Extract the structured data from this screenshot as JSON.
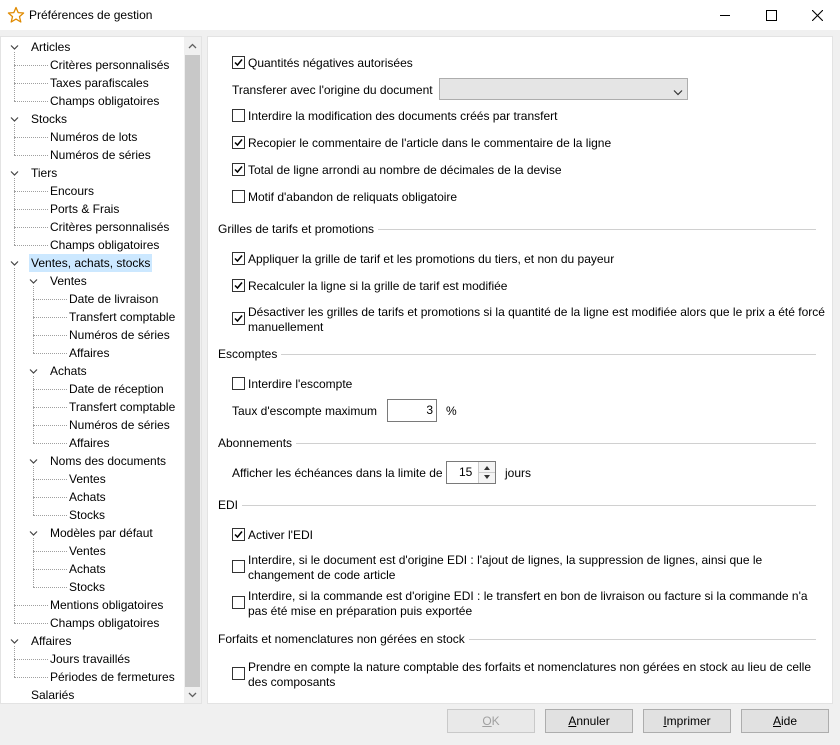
{
  "window": {
    "title": "Préférences de gestion"
  },
  "tree": [
    {
      "label": "Articles",
      "level": 0,
      "expanded": true
    },
    {
      "label": "Critères personnalisés",
      "level": 1
    },
    {
      "label": "Taxes parafiscales",
      "level": 1
    },
    {
      "label": "Champs obligatoires",
      "level": 1
    },
    {
      "label": "Stocks",
      "level": 0,
      "expanded": true
    },
    {
      "label": "Numéros de lots",
      "level": 1
    },
    {
      "label": "Numéros de séries",
      "level": 1
    },
    {
      "label": "Tiers",
      "level": 0,
      "expanded": true
    },
    {
      "label": "Encours",
      "level": 1
    },
    {
      "label": "Ports & Frais",
      "level": 1
    },
    {
      "label": "Critères personnalisés",
      "level": 1
    },
    {
      "label": "Champs obligatoires",
      "level": 1
    },
    {
      "label": "Ventes, achats, stocks",
      "level": 0,
      "expanded": true,
      "selected": true
    },
    {
      "label": "Ventes",
      "level": 1,
      "expanded": true
    },
    {
      "label": "Date de livraison",
      "level": 2
    },
    {
      "label": "Transfert comptable",
      "level": 2
    },
    {
      "label": "Numéros de séries",
      "level": 2
    },
    {
      "label": "Affaires",
      "level": 2
    },
    {
      "label": "Achats",
      "level": 1,
      "expanded": true
    },
    {
      "label": "Date de réception",
      "level": 2
    },
    {
      "label": "Transfert comptable",
      "level": 2
    },
    {
      "label": "Numéros de séries",
      "level": 2
    },
    {
      "label": "Affaires",
      "level": 2
    },
    {
      "label": "Noms des documents",
      "level": 1,
      "expanded": true
    },
    {
      "label": "Ventes",
      "level": 2
    },
    {
      "label": "Achats",
      "level": 2
    },
    {
      "label": "Stocks",
      "level": 2
    },
    {
      "label": "Modèles par défaut",
      "level": 1,
      "expanded": true
    },
    {
      "label": "Ventes",
      "level": 2
    },
    {
      "label": "Achats",
      "level": 2
    },
    {
      "label": "Stocks",
      "level": 2
    },
    {
      "label": "Mentions obligatoires",
      "level": 1
    },
    {
      "label": "Champs obligatoires",
      "level": 1
    },
    {
      "label": "Affaires",
      "level": 0,
      "expanded": true
    },
    {
      "label": "Jours travaillés",
      "level": 1
    },
    {
      "label": "Périodes de fermetures",
      "level": 1
    },
    {
      "label": "Salariés",
      "level": 0,
      "expanded": true
    }
  ],
  "panel": {
    "items": [
      {
        "type": "checkbox",
        "label": "Quantités négatives autorisées",
        "checked": true
      },
      {
        "type": "combo",
        "label": "Transferer avec l'origine du document",
        "value": ""
      },
      {
        "type": "checkbox",
        "label": "Interdire la modification des documents créés par transfert",
        "checked": false
      },
      {
        "type": "checkbox",
        "label": "Recopier le commentaire de l'article dans le commentaire de la ligne",
        "checked": true
      },
      {
        "type": "checkbox",
        "label": "Total de ligne arrondi au nombre de décimales de la devise",
        "checked": true
      },
      {
        "type": "checkbox",
        "label": "Motif d'abandon de reliquats obligatoire",
        "checked": false
      },
      {
        "type": "section",
        "label": "Grilles de tarifs et promotions"
      },
      {
        "type": "checkbox",
        "label": "Appliquer la grille de tarif et les promotions du tiers, et non du payeur",
        "checked": true
      },
      {
        "type": "checkbox",
        "label": "Recalculer la ligne si la grille de tarif est modifiée",
        "checked": true
      },
      {
        "type": "checkbox",
        "label": "Désactiver les grilles de tarifs et promotions si la quantité de la ligne est modifiée alors que le prix a été forcé",
        "label2": "manuellement",
        "checked": true
      },
      {
        "type": "section",
        "label": "Escomptes"
      },
      {
        "type": "checkbox",
        "label": "Interdire l'escompte",
        "checked": false
      },
      {
        "type": "number",
        "label": "Taux d'escompte maximum",
        "value": "3",
        "unit": "%"
      },
      {
        "type": "section",
        "label": "Abonnements"
      },
      {
        "type": "spinner",
        "label": "Afficher les échéances dans la limite de",
        "value": "15",
        "unit": "jours"
      },
      {
        "type": "section",
        "label": "EDI"
      },
      {
        "type": "checkbox",
        "label": "Activer l'EDI",
        "checked": true
      },
      {
        "type": "checkbox",
        "label": "Interdire, si le document est d'origine EDI : l'ajout de lignes, la suppression de lignes, ainsi que le",
        "label2": "changement de code article",
        "checked": false
      },
      {
        "type": "checkbox",
        "label": "Interdire, si la commande est d'origine EDI : le transfert en bon de livraison ou facture si la commande n'a",
        "label2": "pas été mise en préparation puis exportée",
        "checked": false
      },
      {
        "type": "section",
        "label": "Forfaits et nomenclatures non gérées en stock"
      },
      {
        "type": "checkbox",
        "label": "Prendre en compte la nature comptable des forfaits et nomenclatures non gérées en stock au lieu de celle",
        "label2": "des composants",
        "checked": false
      }
    ]
  },
  "buttons": [
    {
      "label": "OK",
      "mnemonic": "O",
      "disabled": true
    },
    {
      "label": "Annuler",
      "mnemonic": "A",
      "disabled": false
    },
    {
      "label": "Imprimer",
      "mnemonic": "I",
      "disabled": false
    },
    {
      "label": "Aide",
      "mnemonic": "A",
      "disabled": false
    }
  ]
}
